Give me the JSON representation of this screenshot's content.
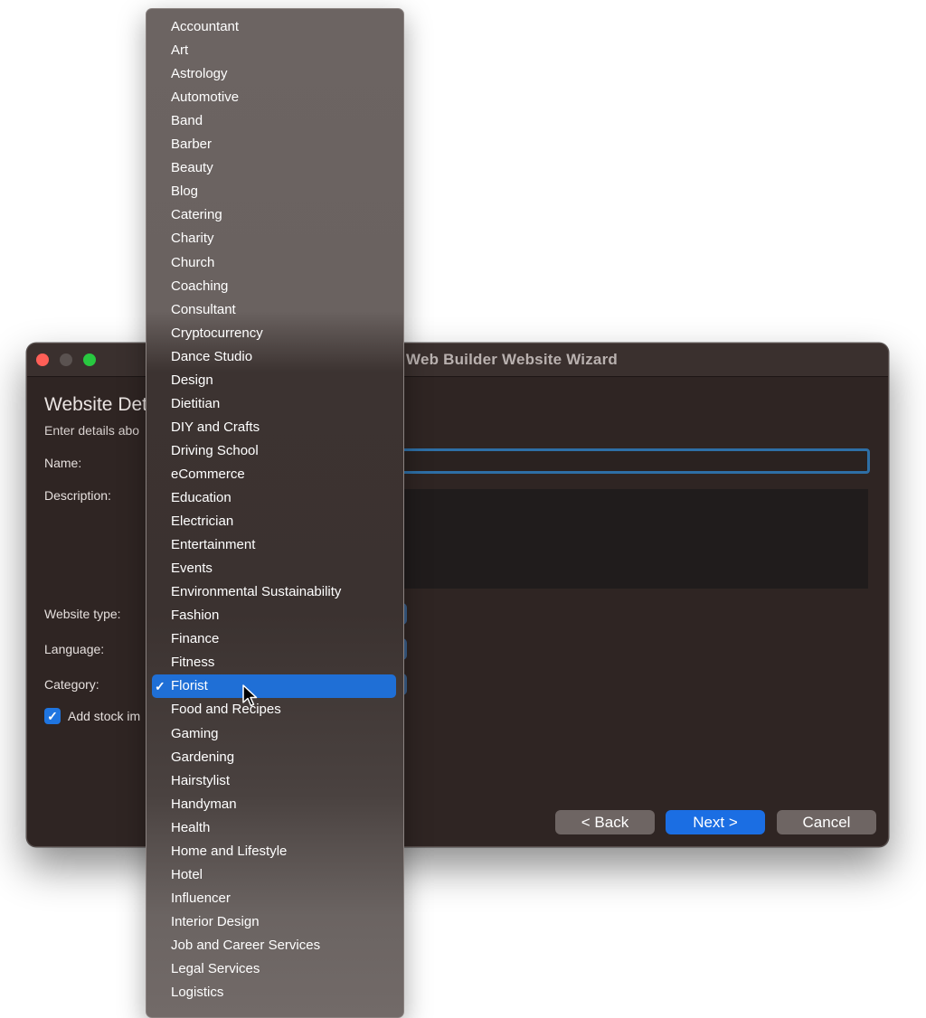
{
  "window": {
    "title": "Web Builder Website Wizard",
    "heading": "Website Det",
    "subheading": "Enter details abo",
    "labels": {
      "name": "Name:",
      "description": "Description:",
      "website_type": "Website type:",
      "language": "Language:",
      "category": "Category:"
    },
    "stock_images": {
      "label": "Add stock im",
      "checked": true,
      "check_glyph": "✓"
    },
    "buttons": {
      "back": "< Back",
      "next": "Next >",
      "cancel": "Cancel"
    }
  },
  "menu": {
    "selected": "Florist",
    "check_glyph": "✓",
    "items": [
      "Accountant",
      "Art",
      "Astrology",
      "Automotive",
      "Band",
      "Barber",
      "Beauty",
      "Blog",
      "Catering",
      "Charity",
      "Church",
      "Coaching",
      "Consultant",
      "Cryptocurrency",
      "Dance Studio",
      "Design",
      "Dietitian",
      "DIY and Crafts",
      "Driving School",
      "eCommerce",
      "Education",
      "Electrician",
      "Entertainment",
      "Events",
      "Environmental Sustainability",
      "Fashion",
      "Finance",
      "Fitness",
      "Florist",
      "Food and Recipes",
      "Gaming",
      "Gardening",
      "Hairstylist",
      "Handyman",
      "Health",
      "Home and Lifestyle",
      "Hotel",
      "Influencer",
      "Interior Design",
      "Job and Career Services",
      "Legal Services",
      "Logistics"
    ]
  },
  "colors": {
    "accent": "#1f6fd6",
    "close": "#ff5f57",
    "zoom": "#28c840"
  },
  "icons": {
    "cursor": "arrow-pointer-icon"
  }
}
